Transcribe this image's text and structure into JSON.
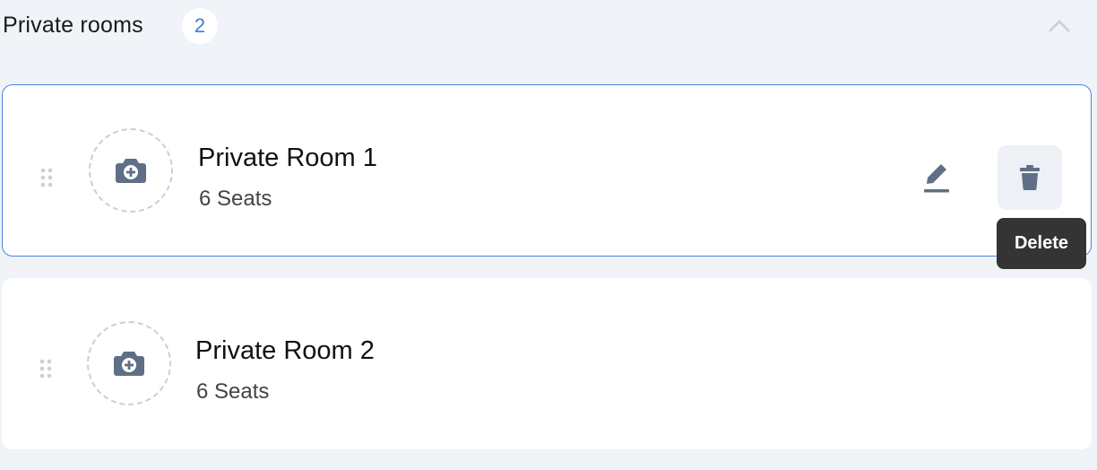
{
  "section": {
    "title": "Private rooms",
    "count": "2"
  },
  "rooms": [
    {
      "name": "Private Room 1",
      "seats": "6 Seats"
    },
    {
      "name": "Private Room 2",
      "seats": "6 Seats"
    }
  ],
  "tooltip": {
    "delete_label": "Delete"
  },
  "icons": {
    "collapse": "chevron-up-icon",
    "drag": "drag-handle-icon",
    "photo": "camera-add-icon",
    "edit": "pencil-icon",
    "delete": "trash-icon"
  },
  "colors": {
    "accent": "#3b7ddd",
    "background": "#f0f3f7",
    "icon": "#5f6f85"
  }
}
